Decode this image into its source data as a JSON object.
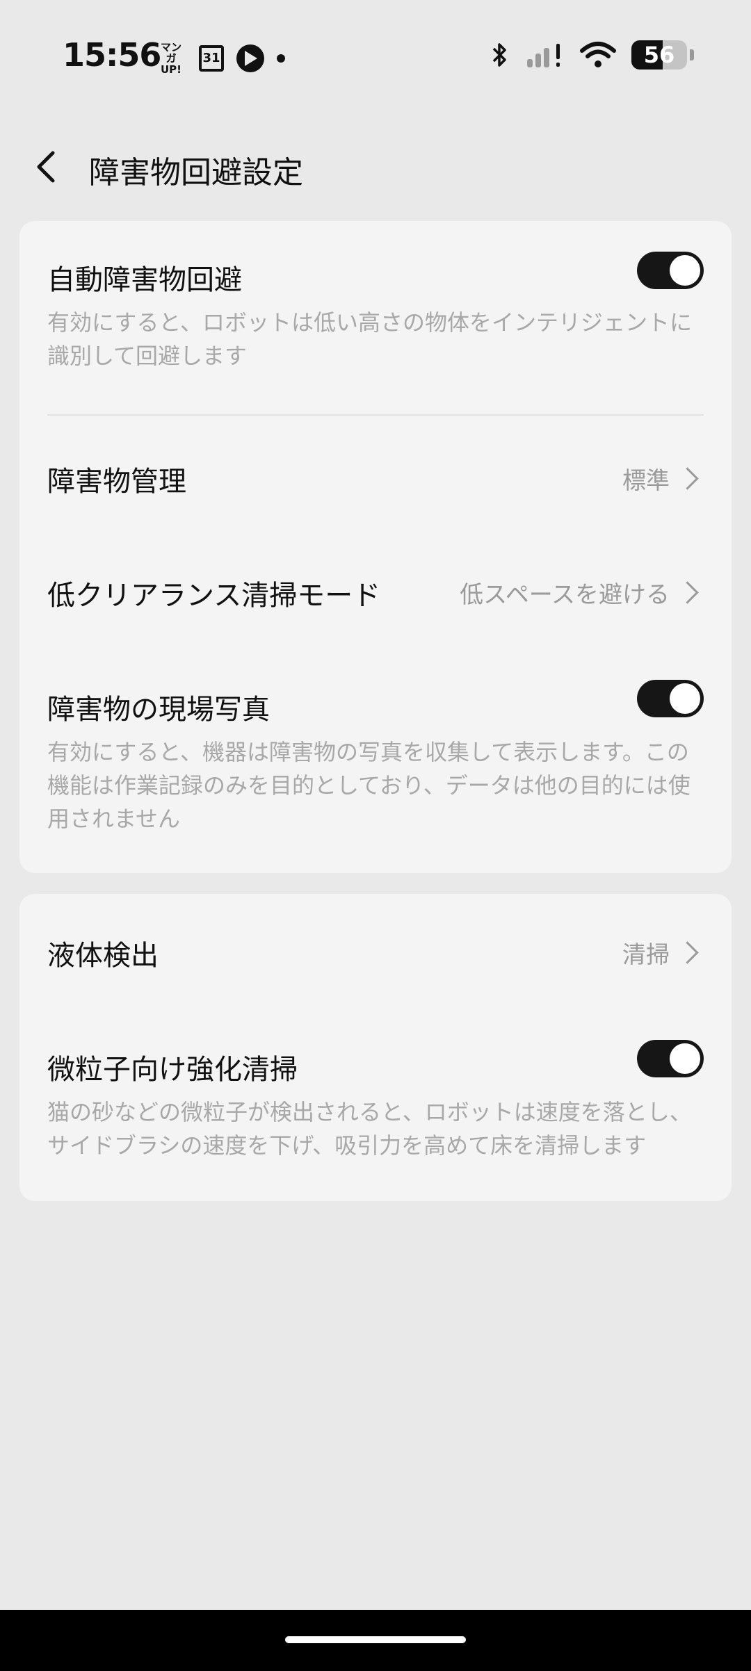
{
  "status_bar": {
    "time": "15:56",
    "manga_badge_line1": "マンガ",
    "manga_badge_line2": "UP!",
    "calendar_day": "31",
    "battery_level": "56"
  },
  "header": {
    "title": "障害物回避設定"
  },
  "card1": {
    "auto_avoid": {
      "title": "自動障害物回避",
      "description": "有効にすると、ロボットは低い高さの物体をインテリジェントに識別して回避します",
      "enabled": true
    },
    "obstacle_management": {
      "title": "障害物管理",
      "value": "標準"
    },
    "low_clearance": {
      "title": "低クリアランス清掃モード",
      "value": "低スペースを避ける"
    },
    "scene_photos": {
      "title": "障害物の現場写真",
      "description": "有効にすると、機器は障害物の写真を収集して表示します。この機能は作業記録のみを目的としており、データは他の目的には使用されません",
      "enabled": true
    }
  },
  "card2": {
    "liquid_detection": {
      "title": "液体検出",
      "value": "清掃"
    },
    "fine_particle": {
      "title": "微粒子向け強化清掃",
      "description": "猫の砂などの微粒子が検出されると、ロボットは速度を落とし、サイドブラシの速度を下げ、吸引力を高めて床を清掃します",
      "enabled": true
    }
  },
  "colors": {
    "background": "#e9e9e9",
    "card": "#f4f4f4",
    "toggle_on": "#161616",
    "secondary_text": "#a8a8a8"
  }
}
